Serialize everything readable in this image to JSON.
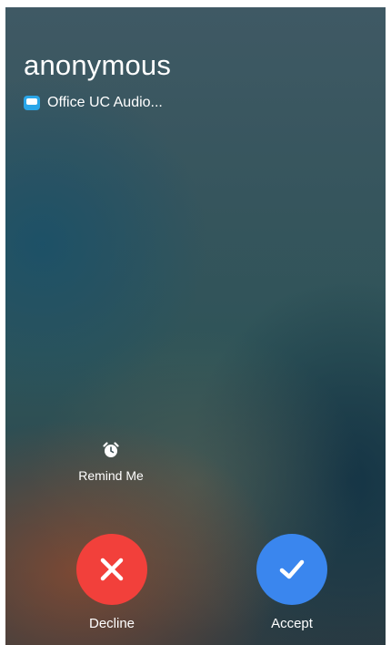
{
  "incoming_call": {
    "caller_name": "anonymous",
    "source_app": "Office UC Audio...",
    "remind_label": "Remind Me",
    "decline_label": "Decline",
    "accept_label": "Accept"
  },
  "icons": {
    "source": "office-uc-app-icon",
    "remind": "alarm-clock-icon",
    "decline": "x-icon",
    "accept": "checkmark-icon"
  },
  "colors": {
    "decline": "#f2403b",
    "accept": "#3a86ee",
    "text": "#ffffff"
  }
}
